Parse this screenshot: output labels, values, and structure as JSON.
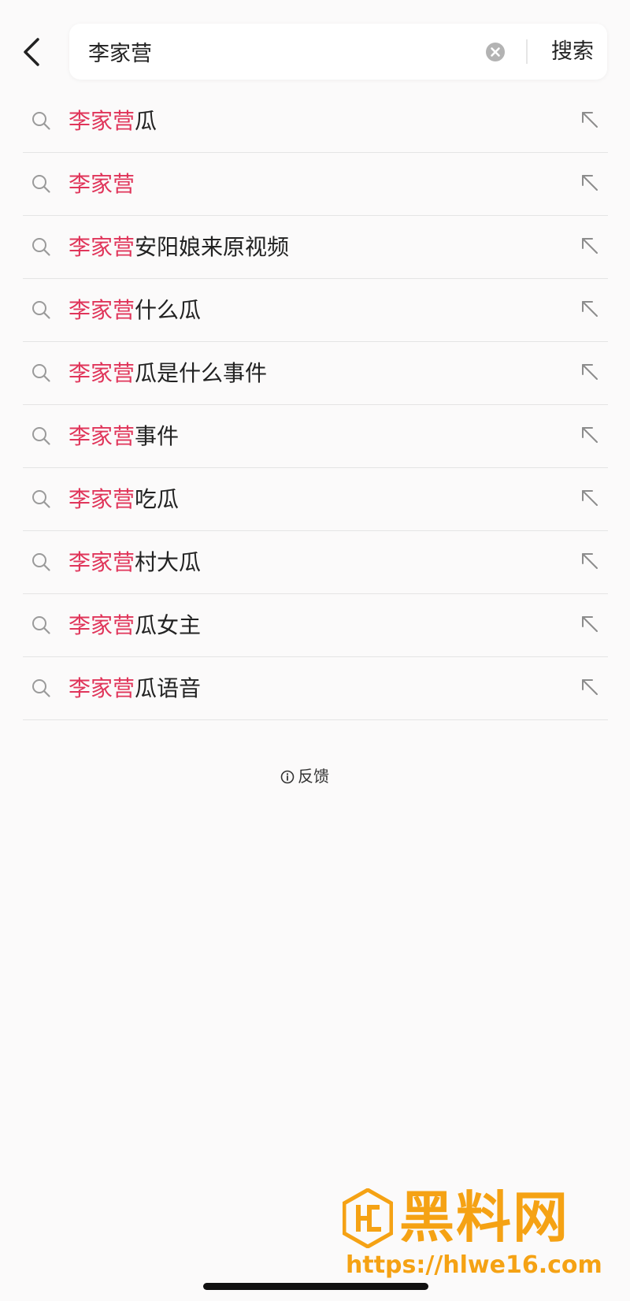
{
  "header": {
    "query": "李家营",
    "search_label": "搜索",
    "back_icon": "chevron-left-icon",
    "clear_icon": "clear-circle-icon"
  },
  "suggestions": [
    {
      "highlight": "李家营",
      "rest": "瓜"
    },
    {
      "highlight": "李家营",
      "rest": ""
    },
    {
      "highlight": "李家营",
      "rest": "安阳娘来原视频"
    },
    {
      "highlight": "李家营",
      "rest": "什么瓜"
    },
    {
      "highlight": "李家营",
      "rest": "瓜是什么事件"
    },
    {
      "highlight": "李家营",
      "rest": "事件"
    },
    {
      "highlight": "李家营",
      "rest": "吃瓜"
    },
    {
      "highlight": "李家营",
      "rest": "村大瓜"
    },
    {
      "highlight": "李家营",
      "rest": "瓜女主"
    },
    {
      "highlight": "李家营",
      "rest": "瓜语音"
    }
  ],
  "feedback": {
    "label": "反馈",
    "icon": "info-icon"
  },
  "watermark": {
    "title": "黑料网",
    "url": "https://hlwe16.com"
  },
  "colors": {
    "highlight": "#e0355a",
    "text": "#222222",
    "watermark": "#f5a214",
    "background": "#fbfafa"
  }
}
